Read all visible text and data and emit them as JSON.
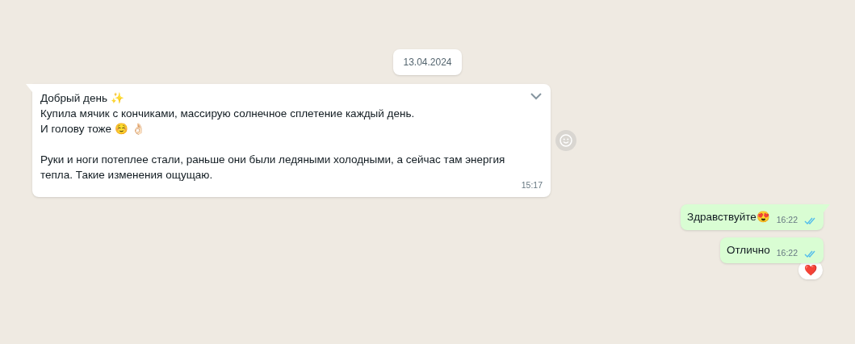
{
  "date_chip": "13.04.2024",
  "messages": [
    {
      "kind": "incoming",
      "text": "Добрый день ✨\nКупила мячик с кончиками, массирую солнечное сплетение каждый день.\nИ голову тоже ☺️ 👌🏻\n\nРуки и ноги потеплее стали, раньше они были ледяными холодными, а сейчас там энергия\nтепла. Такие изменения ощущаю.",
      "time": "15:17",
      "tail": true
    },
    {
      "kind": "outgoing",
      "text": "Здравствуйте😍",
      "time": "16:22",
      "read": true,
      "tail": true
    },
    {
      "kind": "outgoing",
      "text": "Отлично",
      "time": "16:22",
      "read": true,
      "tail": false,
      "reaction": "❤️"
    }
  ]
}
